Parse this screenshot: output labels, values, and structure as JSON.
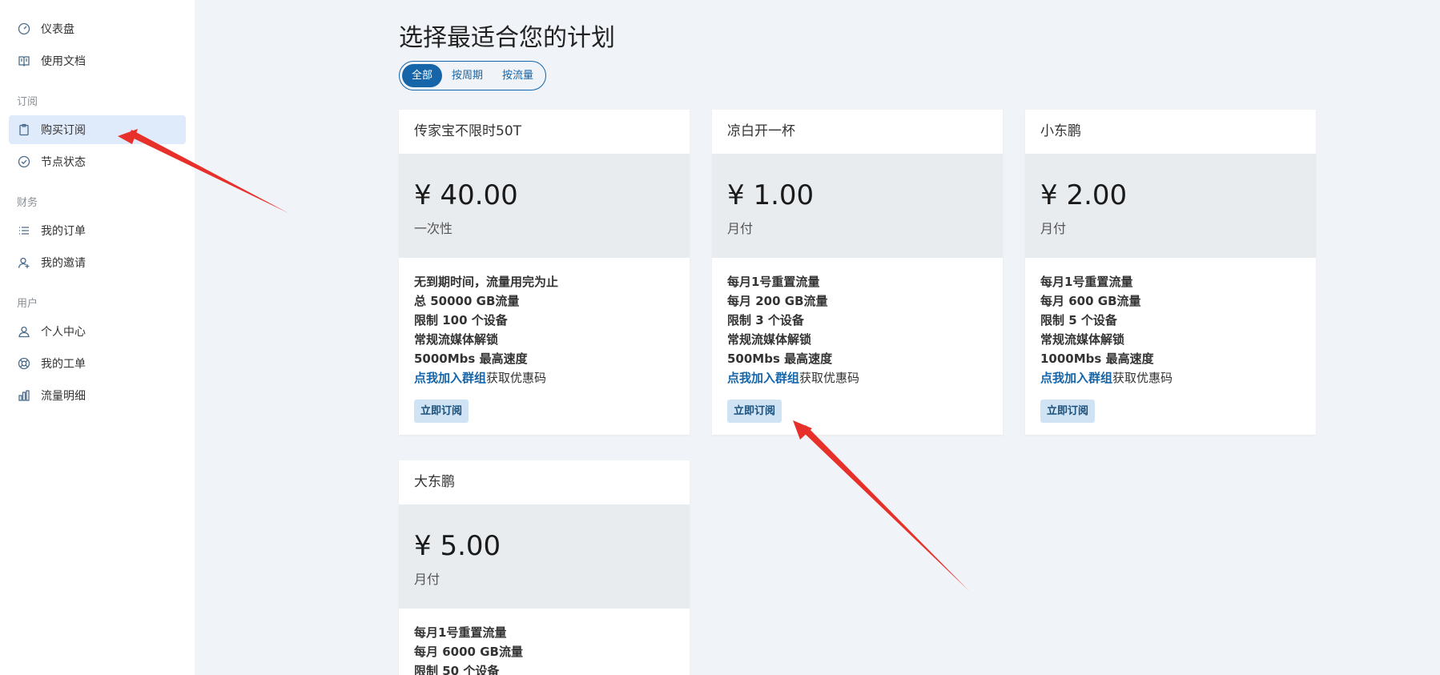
{
  "sidebar": {
    "top_items": [
      {
        "label": "仪表盘",
        "icon": "dashboard-gauge-icon"
      },
      {
        "label": "使用文档",
        "icon": "book-icon"
      }
    ],
    "sections": [
      {
        "title": "订阅",
        "items": [
          {
            "label": "购买订阅",
            "icon": "clipboard-icon",
            "active": true
          },
          {
            "label": "节点状态",
            "icon": "check-circle-icon"
          }
        ]
      },
      {
        "title": "财务",
        "items": [
          {
            "label": "我的订单",
            "icon": "list-icon"
          },
          {
            "label": "我的邀请",
            "icon": "user-invite-icon"
          }
        ]
      },
      {
        "title": "用户",
        "items": [
          {
            "label": "个人中心",
            "icon": "user-icon"
          },
          {
            "label": "我的工单",
            "icon": "support-lifebuoy-icon"
          },
          {
            "label": "流量明细",
            "icon": "bar-chart-icon"
          }
        ]
      }
    ]
  },
  "main": {
    "title": "选择最适合您的计划",
    "filters": [
      {
        "label": "全部",
        "active": true
      },
      {
        "label": "按周期"
      },
      {
        "label": "按流量"
      }
    ],
    "plans": [
      {
        "name": "传家宝不限时50T",
        "price": "¥ 40.00",
        "period": "一次性",
        "features": [
          "无到期时间，流量用完为止",
          "总 50000 GB流量",
          "限制 100 个设备",
          "常规流媒体解锁",
          "5000Mbs 最高速度"
        ],
        "link_text": "点我加入群组",
        "link_suffix": "获取优惠码",
        "button": "立即订阅"
      },
      {
        "name": "凉白开一杯",
        "price": "¥ 1.00",
        "period": "月付",
        "features": [
          "每月1号重置流量",
          "每月 200 GB流量",
          "限制 3 个设备",
          "常规流媒体解锁",
          "500Mbs 最高速度"
        ],
        "link_text": "点我加入群组",
        "link_suffix": "获取优惠码",
        "button": "立即订阅"
      },
      {
        "name": "小东鹏",
        "price": "¥ 2.00",
        "period": "月付",
        "features": [
          "每月1号重置流量",
          "每月 600 GB流量",
          "限制 5 个设备",
          "常规流媒体解锁",
          "1000Mbs 最高速度"
        ],
        "link_text": "点我加入群组",
        "link_suffix": "获取优惠码",
        "button": "立即订阅"
      },
      {
        "name": "大东鹏",
        "price": "¥ 5.00",
        "period": "月付",
        "features": [
          "每月1号重置流量",
          "每月 6000 GB流量",
          "限制 50 个设备"
        ]
      }
    ]
  },
  "colors": {
    "accent": "#1565a8",
    "annotation_arrow": "#e8302a",
    "sidebar_active_bg": "#dfebfa",
    "page_bg": "#f0f3f7"
  }
}
